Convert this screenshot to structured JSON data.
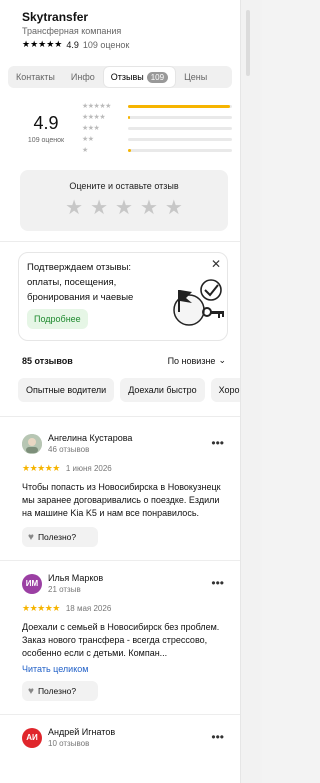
{
  "company": {
    "name": "Skytransfer",
    "category": "Трансферная компания",
    "rating_text": "4.9",
    "reviews_count_text": "109 оценок"
  },
  "tabs": [
    {
      "label": "Контакты"
    },
    {
      "label": "Инфо"
    },
    {
      "label": "Отзывы",
      "badge": "109"
    },
    {
      "label": "Цены"
    }
  ],
  "summary": {
    "avg": "4.9",
    "count": "109 оценок",
    "distribution": [
      {
        "stars": 5,
        "fraction": 0.98
      },
      {
        "stars": 4,
        "fraction": 0.02
      },
      {
        "stars": 3,
        "fraction": 0.0
      },
      {
        "stars": 2,
        "fraction": 0.0
      },
      {
        "stars": 1,
        "fraction": 0.03
      }
    ]
  },
  "rate_prompt": {
    "label": "Оцените и оставьте отзыв"
  },
  "confirm_card": {
    "text": "Подтверждаем отзывы: оплаты, посещения, бронирования и чаевые",
    "button": "Подробнее"
  },
  "reviews_header": {
    "count": "85 отзывов",
    "sort": "По новизне"
  },
  "chips": [
    {
      "label": "Опытные водители"
    },
    {
      "label": "Доехали быстро"
    },
    {
      "label": "Хорошая цена"
    }
  ],
  "reviews": [
    {
      "name": "Ангелина Кустарова",
      "count": "46 отзывов",
      "date": "1 июня 2026",
      "text": "Чтобы попасть из Новосибирска в Новокузнецк мы заранее договаривались о поездке. Ездили на машине Kia K5 и нам все понравилось.",
      "helpful": "Полезно?",
      "avatar_color": "#a0b0a0",
      "avatar_initials": ""
    },
    {
      "name": "Илья Марков",
      "count": "21 отзыв",
      "date": "18 мая 2026",
      "text": "Доехали с семьей в Новосибирск без проблем. Заказ нового трансфера - всегда стрессово, особенно если с детьми. Компан...",
      "read_more": "Читать целиком",
      "helpful": "Полезно?",
      "avatar_color": "#9b3fa3",
      "avatar_initials": "ИМ"
    },
    {
      "name": "Андрей Игнатов",
      "count": "10 отзывов",
      "avatar_color": "#e0262c",
      "avatar_initials": "АИ"
    }
  ],
  "colors": {
    "accent_star": "#f6b400",
    "link": "#2362c8",
    "badge_bg": "#999999",
    "more_btn_text": "#1f8a2f"
  }
}
